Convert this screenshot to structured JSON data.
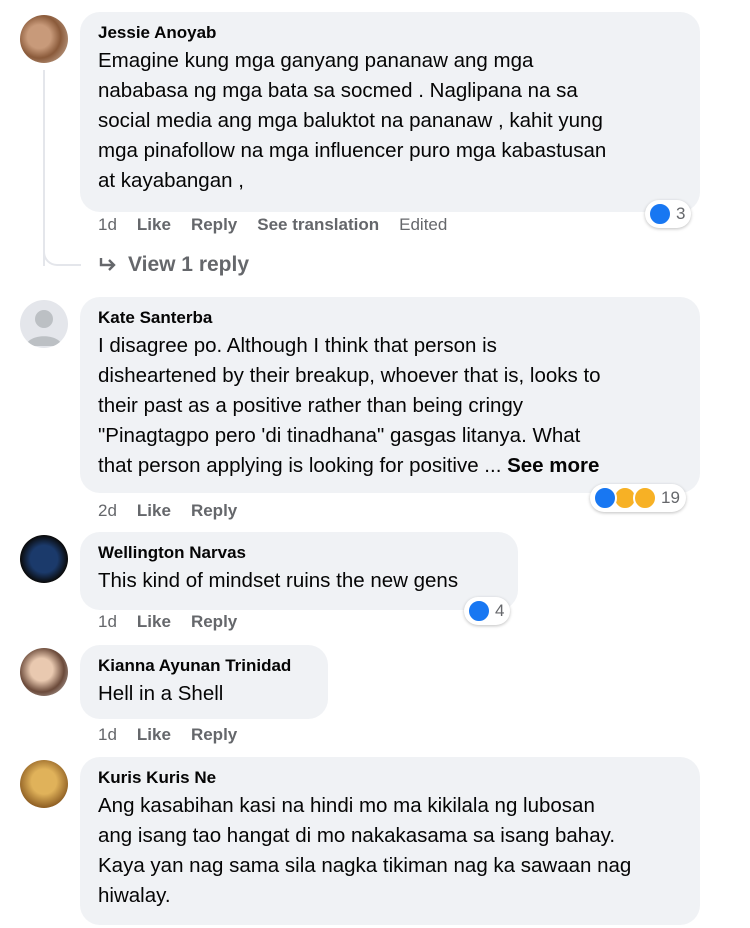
{
  "comments": [
    {
      "author": "Jessie Anoyab",
      "text": "Emagine kung mga ganyang pananaw ang mga\nnababasa ng mga bata sa socmed . Naglipana na sa\nsocial media ang mga baluktot na pananaw , kahit yung\nmga pinafollow na mga influencer puro mga kabastusan\nat kayabangan ,",
      "time": "1d",
      "like": "Like",
      "reply": "Reply",
      "translate": "See translation",
      "edited": "Edited",
      "reactions": "3",
      "view_replies": "View 1 reply"
    },
    {
      "author": "Kate Santerba",
      "text": "I disagree po. Although I think that person is\ndisheartened by their breakup, whoever that is, looks to\ntheir past as a positive rather than being cringy\n\"Pinagtagpo pero 'di tinadhana\" gasgas litanya. What\nthat person applying is looking for positive ...",
      "see_more": "See more",
      "time": "2d",
      "like": "Like",
      "reply": "Reply",
      "reactions": "19"
    },
    {
      "author": "Wellington Narvas",
      "text": "This kind of mindset ruins the new gens",
      "time": "1d",
      "like": "Like",
      "reply": "Reply",
      "reactions": "4"
    },
    {
      "author": "Kianna Ayunan Trinidad",
      "text": "Hell in a Shell",
      "time": "1d",
      "like": "Like",
      "reply": "Reply"
    },
    {
      "author": "Kuris Kuris Ne",
      "text": "Ang kasabihan kasi na hindi mo ma kikilala ng lubosan\nang isang tao hangat di mo nakakasama sa isang bahay.\nKaya yan nag sama sila nagka tikiman nag ka sawaan nag\nhiwalay."
    }
  ],
  "colors": {
    "like_blue": "#1877f2",
    "bubble_bg": "#f0f2f5",
    "meta_gray": "#65676b"
  }
}
